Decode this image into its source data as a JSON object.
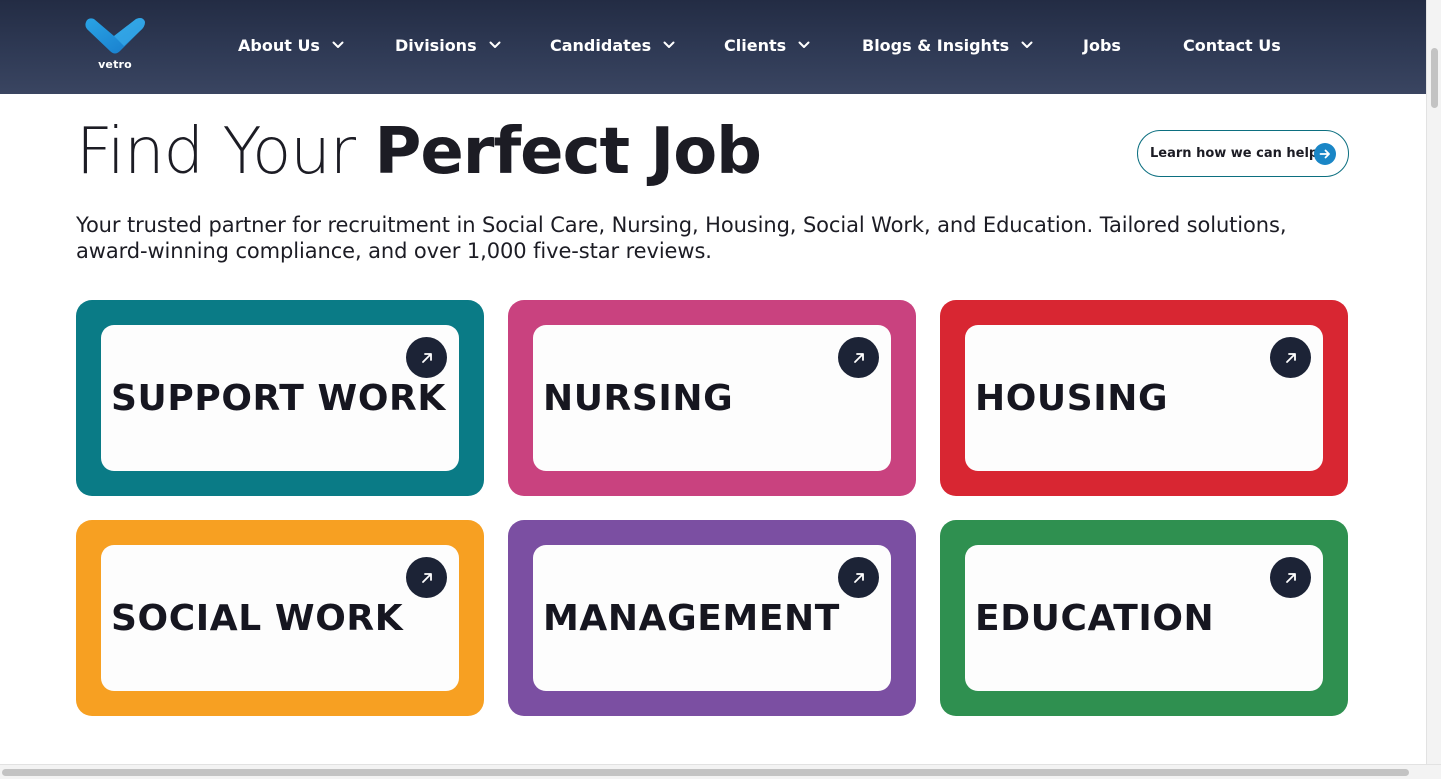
{
  "header": {
    "logo_text": "vetro",
    "nav": [
      {
        "label": "About Us",
        "has_dropdown": true
      },
      {
        "label": "Divisions",
        "has_dropdown": true
      },
      {
        "label": "Candidates",
        "has_dropdown": true
      },
      {
        "label": "Clients",
        "has_dropdown": true
      },
      {
        "label": "Blogs & Insights",
        "has_dropdown": true
      },
      {
        "label": "Jobs",
        "has_dropdown": false
      },
      {
        "label": "Contact Us",
        "has_dropdown": false
      }
    ]
  },
  "hero": {
    "title_light": "Find Your ",
    "title_bold": "Perfect Job",
    "help_button_label": "Learn how we can help",
    "description": "Your trusted partner for recruitment in Social Care, Nursing, Housing, Social Work, and Education. Tailored solutions, award-winning compliance, and over 1,000 five-star reviews."
  },
  "cards": [
    {
      "title": "SUPPORT WORK",
      "color": "#0a7b86",
      "icon": "arrow-up-right-icon"
    },
    {
      "title": "NURSING",
      "color": "#c9427f",
      "icon": "arrow-up-right-icon"
    },
    {
      "title": "HOUSING",
      "color": "#d82632",
      "icon": "arrow-up-right-icon"
    },
    {
      "title": "SOCIAL WORK",
      "color": "#f7a022",
      "icon": "arrow-up-right-icon"
    },
    {
      "title": "MANAGEMENT",
      "color": "#7b4fa2",
      "icon": "arrow-up-right-icon"
    },
    {
      "title": "EDUCATION",
      "color": "#2f9050",
      "icon": "arrow-up-right-icon"
    }
  ],
  "colors": {
    "header_bg": "#2a3450",
    "accent_blue": "#1a86c6",
    "button_border": "#0c6f80",
    "icon_circle": "#1c2336"
  }
}
